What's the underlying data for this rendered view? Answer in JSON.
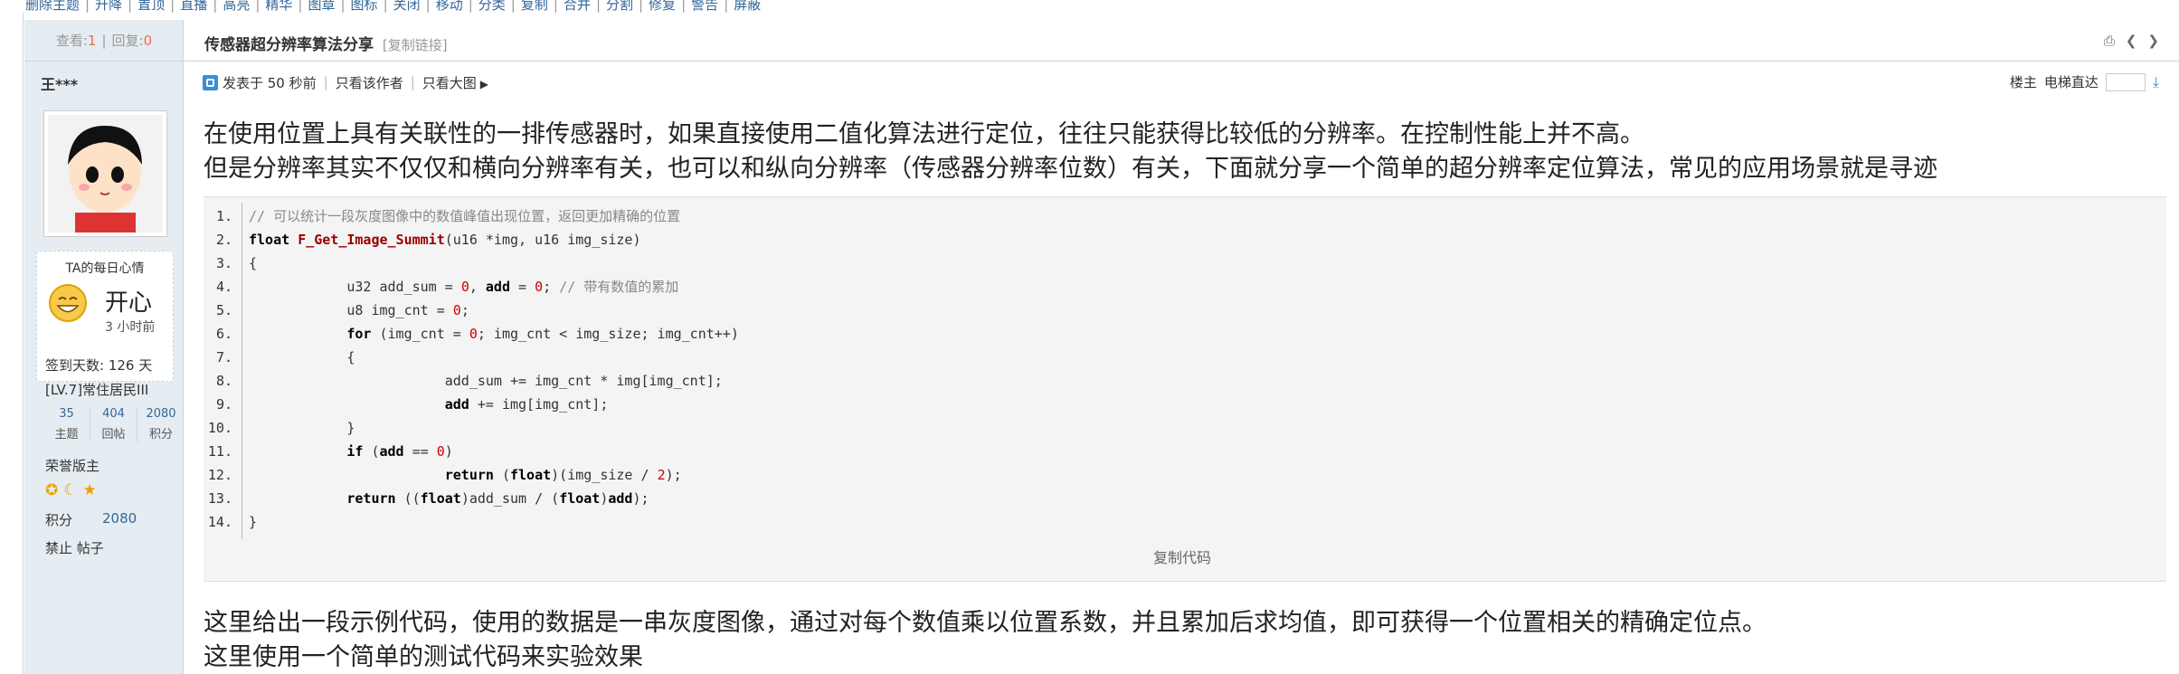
{
  "top_actions": [
    "删除主题",
    "升降",
    "置顶",
    "直播",
    "高亮",
    "精华",
    "图章",
    "图标",
    "关闭",
    "移动",
    "分类",
    "复制",
    "合并",
    "分割",
    "修复",
    "警告",
    "屏蔽"
  ],
  "stats": {
    "view_label": "查看:",
    "views": "1",
    "reply_label": "回复:",
    "replies": "0"
  },
  "thread": {
    "title": "传感器超分辨率算法分享",
    "copy_link": "[复制链接]"
  },
  "user": {
    "name": "王***",
    "mood_title": "TA的每日心情",
    "mood_word": "开心",
    "mood_time": "3 小时前",
    "sign_days": "签到天数: 126 天",
    "level": "[LV.7]常住居民III",
    "counts": [
      {
        "num": "35",
        "label": "主题"
      },
      {
        "num": "404",
        "label": "回帖"
      },
      {
        "num": "2080",
        "label": "积分"
      }
    ],
    "rank": "荣誉版主",
    "medals": [
      "sun-medal-icon",
      "moon-medal-icon",
      "star-medal-icon"
    ],
    "score_label": "积分",
    "score_value": "2080",
    "banned": "禁止 帖子"
  },
  "post_meta": {
    "posted": "发表于 50 秒前",
    "only_author": "只看该作者",
    "only_big": "只看大图"
  },
  "floor": {
    "louzhu": "楼主",
    "jump": "电梯直达"
  },
  "paragraphs": [
    "在使用位置上具有关联性的一排传感器时，如果直接使用二值化算法进行定位，往往只能获得比较低的分辨率。在控制性能上并不高。",
    "但是分辨率其实不仅仅和横向分辨率有关，也可以和纵向分辨率（传感器分辨率位数）有关，下面就分享一个简单的超分辨率定位算法，常见的应用场景就是寻迹",
    "这里给出一段示例代码，使用的数据是一串灰度图像，通过对每个数值乘以位置系数，并且累加后求均值，即可获得一个位置相关的精确定位点。",
    "这里使用一个简单的测试代码来实验效果"
  ],
  "code_lines": [
    {
      "n": "1.",
      "t": "// 可以统计一段灰度图像中的数值峰值出现位置，返回更加精确的位置"
    },
    {
      "n": "2.",
      "t": "float F_Get_Image_Summit(u16 *img, u16 img_size)"
    },
    {
      "n": "3.",
      "t": "{"
    },
    {
      "n": "4.",
      "t": "            u32 add_sum = 0, add = 0; // 带有数值的累加"
    },
    {
      "n": "5.",
      "t": "            u8 img_cnt = 0;"
    },
    {
      "n": "6.",
      "t": "            for (img_cnt = 0; img_cnt < img_size; img_cnt++)"
    },
    {
      "n": "7.",
      "t": "            {"
    },
    {
      "n": "8.",
      "t": "                        add_sum += img_cnt * img[img_cnt];"
    },
    {
      "n": "9.",
      "t": "                        add += img[img_cnt];"
    },
    {
      "n": "10.",
      "t": "            }"
    },
    {
      "n": "11.",
      "t": "            if (add == 0)"
    },
    {
      "n": "12.",
      "t": "                        return (float)(img_size / 2);"
    },
    {
      "n": "13.",
      "t": "            return ((float)add_sum / (float)add);"
    },
    {
      "n": "14.",
      "t": "}"
    }
  ],
  "copy_code": "复制代码"
}
